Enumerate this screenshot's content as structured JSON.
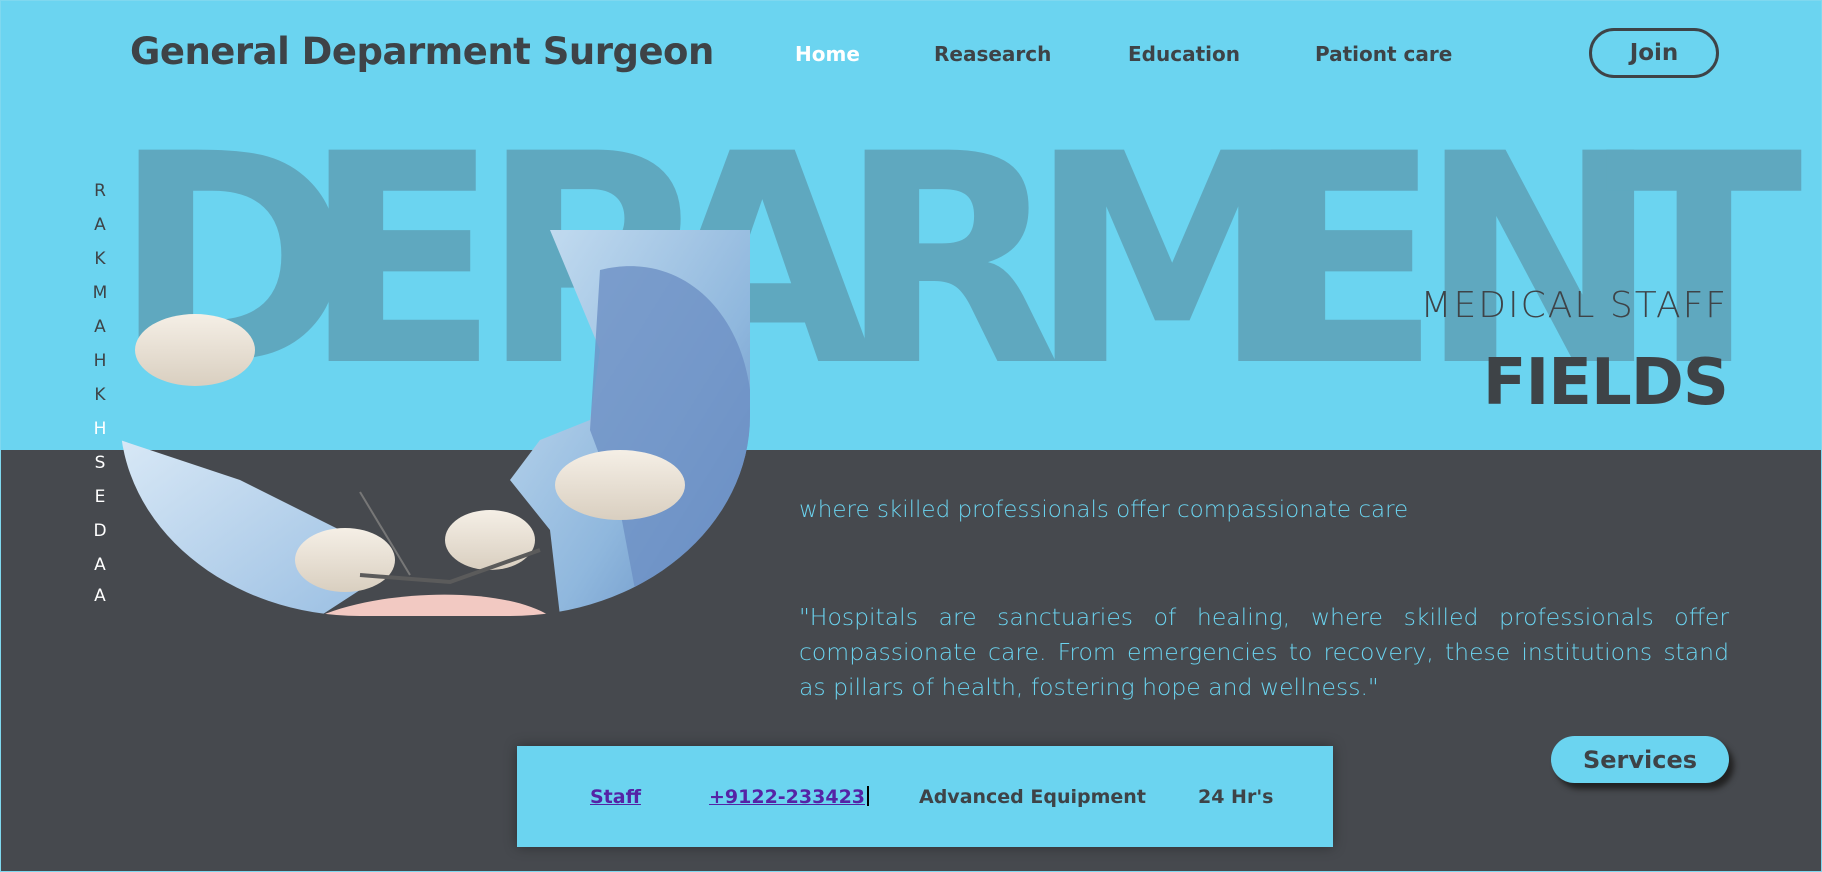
{
  "header": {
    "brand": "General Deparment Surgeon",
    "nav": [
      {
        "label": "Home",
        "active": true
      },
      {
        "label": "Reasearch",
        "active": false
      },
      {
        "label": "Education",
        "active": false
      },
      {
        "label": "Pationt care",
        "active": false
      }
    ],
    "join_label": "Join"
  },
  "hero": {
    "big_letters": [
      "D",
      "E",
      "P",
      "A",
      "R",
      "M",
      "E",
      "N",
      "T"
    ],
    "vertical_name": [
      "A",
      "A",
      "D",
      "E",
      "S",
      "H",
      "K",
      "H",
      "A",
      "M",
      "K",
      "A",
      "R"
    ],
    "subtitle": "MEDICAL STAFF",
    "title": "FIELDS"
  },
  "content": {
    "tagline": "where skilled professionals offer compassionate care",
    "quote": "\"Hospitals are sanctuaries of healing, where skilled professionals offer compassionate care. From emergencies to recovery, these institutions stand as pillars of health, fostering hope and wellness.\"",
    "services_label": "Services"
  },
  "info_bar": {
    "staff_link": "Staff",
    "phone_link": "+9122-233423",
    "equipment": "Advanced Equipment",
    "hours": "24 Hr's"
  },
  "colors": {
    "sky": "#6bd4f0",
    "slate": "#46494e",
    "big_text": "#5fa8bf",
    "link": "#5523a6"
  }
}
